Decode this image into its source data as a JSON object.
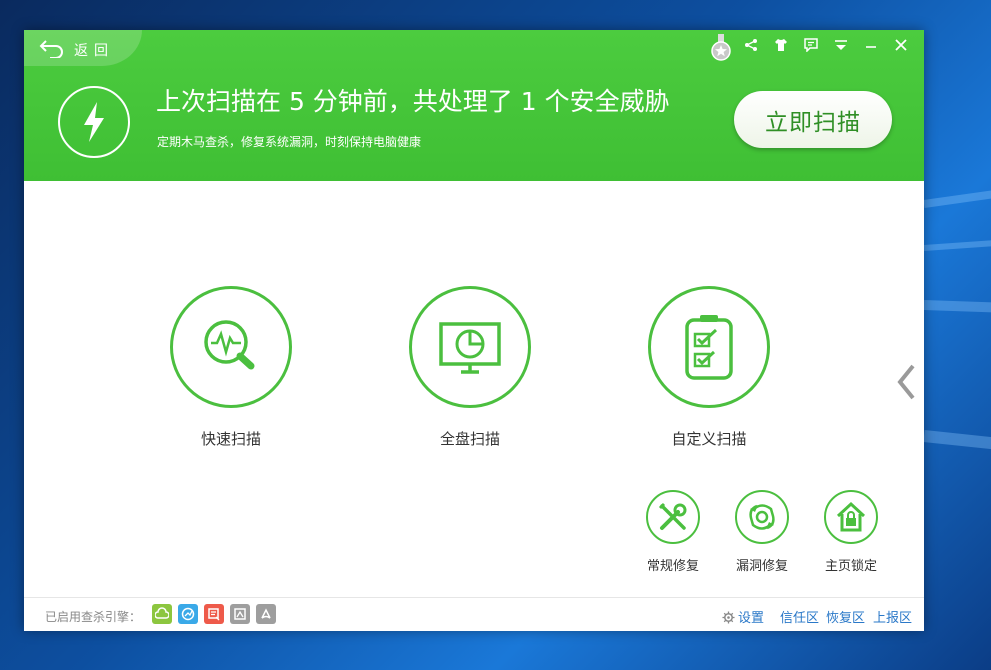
{
  "colors": {
    "brand_green": "#3fbf34",
    "accent_green": "#4bbf3f",
    "link_blue": "#2a78c8",
    "engine_colors": [
      "#8cc63f",
      "#3aa9e8",
      "#ee5a4a",
      "#9e9e9e",
      "#9e9e9e"
    ]
  },
  "header": {
    "back_label": "返回",
    "headline": "上次扫描在 5 分钟前，共处理了 1 个安全威胁",
    "subline": "定期木马查杀，修复系统漏洞，时刻保持电脑健康",
    "scan_now_label": "立即扫描",
    "window_controls": [
      "medal-icon",
      "share-icon",
      "skin-icon",
      "message-icon",
      "menu-icon",
      "minimize-icon",
      "close-icon"
    ]
  },
  "main": {
    "scan_options": [
      {
        "label": "快速扫描",
        "icon": "quick-scan-icon"
      },
      {
        "label": "全盘扫描",
        "icon": "full-scan-icon"
      },
      {
        "label": "自定义扫描",
        "icon": "custom-scan-icon"
      }
    ],
    "repair_options": [
      {
        "label": "常规修复",
        "icon": "tools-icon"
      },
      {
        "label": "漏洞修复",
        "icon": "vulnerability-icon"
      },
      {
        "label": "主页锁定",
        "icon": "home-lock-icon"
      }
    ]
  },
  "footer": {
    "engines_label": "已启用查杀引擎：",
    "engines": [
      "cloud-engine-icon",
      "qvm-engine-icon",
      "qex-engine-icon",
      "avira-engine-icon",
      "bitdefender-engine-icon"
    ],
    "settings_label": "设置",
    "links": [
      "信任区",
      "恢复区",
      "上报区"
    ]
  }
}
